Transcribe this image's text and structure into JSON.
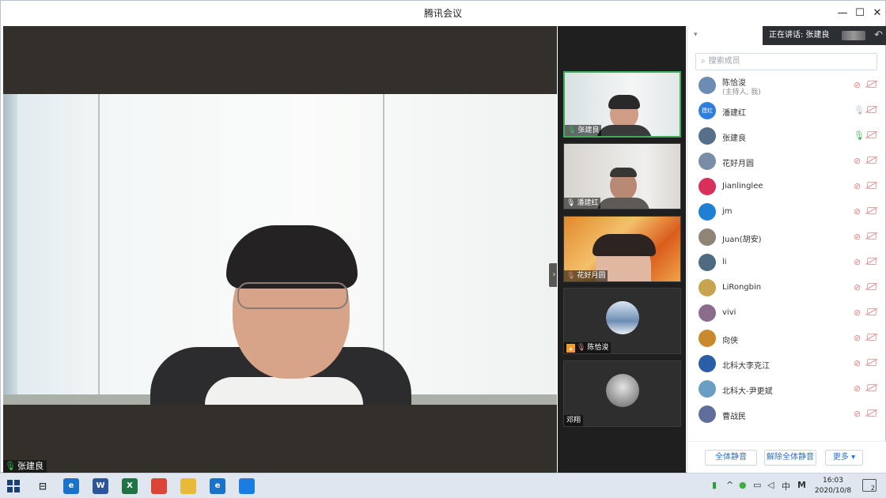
{
  "window": {
    "title": "腾讯会议"
  },
  "main_video": {
    "speaker_name": "张建良"
  },
  "thumbnails": [
    {
      "name": "张建良",
      "mic": "on",
      "host": false,
      "camera": true
    },
    {
      "name": "潘建红",
      "mic": "idle",
      "host": false,
      "camera": true
    },
    {
      "name": "花好月圆",
      "mic": "muted",
      "host": false,
      "camera": true
    },
    {
      "name": "陈恰浚",
      "mic": "muted",
      "host": true,
      "camera": false
    },
    {
      "name": "邓翔",
      "mic": "none",
      "host": false,
      "camera": false
    }
  ],
  "sidebar": {
    "speaking_label": "正在讲话: 张建良",
    "search_placeholder": "搜索成员",
    "members": [
      {
        "name": "陈恰浚",
        "sub": "(主持人, 我)",
        "mic": "muted",
        "avatar_color": "#6d8cb3"
      },
      {
        "name": "潘建红",
        "sub": "",
        "mic": "idle",
        "avatar_color": "#2d7ee0",
        "avatar_text": "建红"
      },
      {
        "name": "张建良",
        "sub": "",
        "mic": "on",
        "avatar_color": "#56708a"
      },
      {
        "name": "花好月圆",
        "sub": "",
        "mic": "muted",
        "avatar_color": "#7a8da6"
      },
      {
        "name": "Jianlinglee",
        "sub": "",
        "mic": "muted",
        "avatar_color": "#d8305a"
      },
      {
        "name": "jm",
        "sub": "",
        "mic": "muted",
        "avatar_color": "#1f7fd4"
      },
      {
        "name": "Juan(胡安)",
        "sub": "",
        "mic": "muted",
        "avatar_color": "#8f8577"
      },
      {
        "name": "li",
        "sub": "",
        "mic": "muted",
        "avatar_color": "#4e6b80"
      },
      {
        "name": "LiRongbin",
        "sub": "",
        "mic": "muted",
        "avatar_color": "#c8a450"
      },
      {
        "name": "vivi",
        "sub": "",
        "mic": "muted",
        "avatar_color": "#8a6d8c"
      },
      {
        "name": "向侠",
        "sub": "",
        "mic": "muted",
        "avatar_color": "#c98a2e"
      },
      {
        "name": "北科大李克江",
        "sub": "",
        "mic": "muted",
        "avatar_color": "#2a5fa8"
      },
      {
        "name": "北科大-尹更斌",
        "sub": "",
        "mic": "muted",
        "avatar_color": "#6a9fc4"
      },
      {
        "name": "曹战民",
        "sub": "",
        "mic": "muted",
        "avatar_color": "#5f6f9a"
      }
    ],
    "footer": {
      "mute_all": "全体静音",
      "unmute_all": "解除全体静音",
      "more": "更多 ▾"
    }
  },
  "taskbar": {
    "apps": [
      {
        "name": "ie",
        "label": "e",
        "color": "#1a73c9"
      },
      {
        "name": "word",
        "label": "W",
        "color": "#2b579a"
      },
      {
        "name": "excel",
        "label": "X",
        "color": "#217346"
      },
      {
        "name": "chrome",
        "label": "",
        "color": "#db4437"
      },
      {
        "name": "explorer",
        "label": "",
        "color": "#e8b93b"
      },
      {
        "name": "ie2",
        "label": "e",
        "color": "#1a73c9"
      },
      {
        "name": "tencent-meeting",
        "label": "",
        "color": "#1b7ce4"
      }
    ],
    "tray_ime": "中",
    "tray_m": "M",
    "time": "16:03",
    "date": "2020/10/8",
    "notification_count": "2"
  }
}
